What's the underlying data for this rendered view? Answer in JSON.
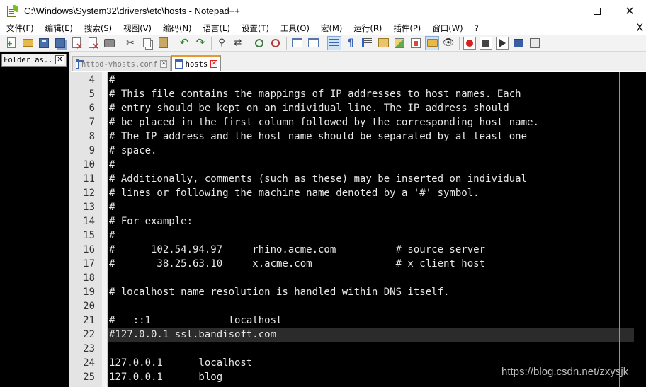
{
  "window": {
    "title": "C:\\Windows\\System32\\drivers\\etc\\hosts - Notepad++"
  },
  "menu": {
    "items": [
      "文件(F)",
      "编辑(E)",
      "搜索(S)",
      "视图(V)",
      "编码(N)",
      "语言(L)",
      "设置(T)",
      "工具(O)",
      "宏(M)",
      "运行(R)",
      "插件(P)",
      "窗口(W)",
      "?"
    ],
    "close_symbol": "X"
  },
  "folder_panel": {
    "tab_label": "Folder as..."
  },
  "tabs": [
    {
      "label": "httpd-vhosts.conf",
      "active": false
    },
    {
      "label": "hosts",
      "active": true
    }
  ],
  "editor": {
    "current_line": 22,
    "lines": [
      {
        "n": "4",
        "text": "#"
      },
      {
        "n": "5",
        "text": "# This file contains the mappings of IP addresses to host names. Each"
      },
      {
        "n": "6",
        "text": "# entry should be kept on an individual line. The IP address should"
      },
      {
        "n": "7",
        "text": "# be placed in the first column followed by the corresponding host name."
      },
      {
        "n": "8",
        "text": "# The IP address and the host name should be separated by at least one"
      },
      {
        "n": "9",
        "text": "# space."
      },
      {
        "n": "10",
        "text": "#"
      },
      {
        "n": "11",
        "text": "# Additionally, comments (such as these) may be inserted on individual"
      },
      {
        "n": "12",
        "text": "# lines or following the machine name denoted by a '#' symbol."
      },
      {
        "n": "13",
        "text": "#"
      },
      {
        "n": "14",
        "text": "# For example:"
      },
      {
        "n": "15",
        "text": "#"
      },
      {
        "n": "16",
        "text": "#      102.54.94.97     rhino.acme.com          # source server"
      },
      {
        "n": "17",
        "text": "#       38.25.63.10     x.acme.com              # x client host"
      },
      {
        "n": "18",
        "text": ""
      },
      {
        "n": "19",
        "text": "# localhost name resolution is handled within DNS itself."
      },
      {
        "n": "20",
        "text": ""
      },
      {
        "n": "21",
        "text": "#   ::1             localhost"
      },
      {
        "n": "22",
        "text": "#127.0.0.1 ssl.bandisoft.com"
      },
      {
        "n": "23",
        "text": ""
      },
      {
        "n": "24",
        "text": "127.0.0.1      localhost"
      },
      {
        "n": "25",
        "text": "127.0.0.1      blog"
      }
    ]
  },
  "watermark": "https://blog.csdn.net/zxysjk",
  "colors": {
    "editor_bg": "#000000",
    "editor_text": "#e8e8e8",
    "current_line_bg": "#2b2b2b",
    "gutter_bg": "#e4e4e4",
    "edge_line": "#3fb6c8",
    "active_tab_accent": "#e69a2c"
  }
}
